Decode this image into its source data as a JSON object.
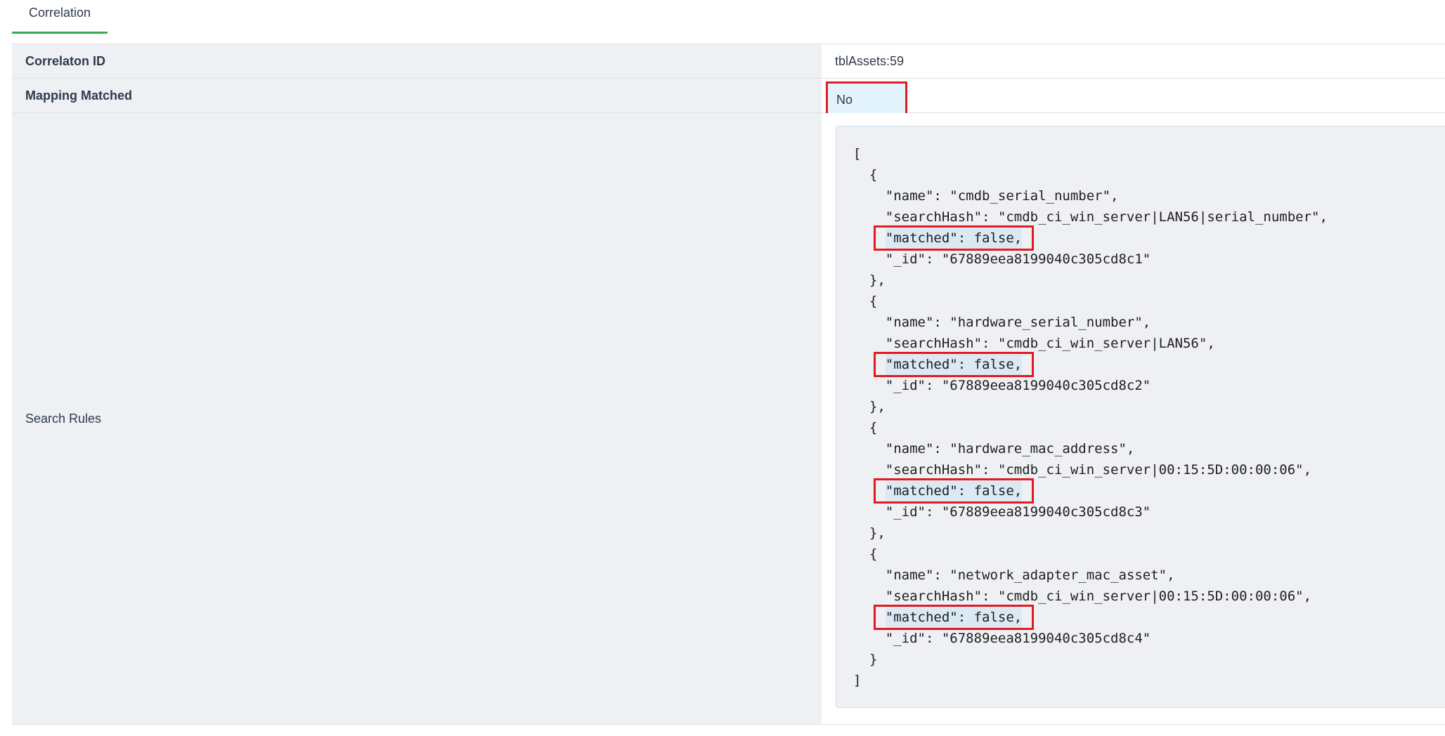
{
  "tabs": [
    {
      "label": "Correlation",
      "active": true
    }
  ],
  "rows": {
    "correlation_id": {
      "label": "Correlaton ID",
      "value": "tblAssets:59"
    },
    "mapping_matched": {
      "label": "Mapping Matched",
      "value": "No"
    },
    "search_rules": {
      "label": "Search Rules"
    }
  },
  "search_rules": {
    "lines": [
      "[",
      "  {",
      "    \"name\": \"cmdb_serial_number\",",
      "    \"searchHash\": \"cmdb_ci_win_server|LAN56|serial_number\",",
      "    \"matched\": false,",
      "    \"_id\": \"67889eea8199040c305cd8c1\"",
      "  },",
      "  {",
      "    \"name\": \"hardware_serial_number\",",
      "    \"searchHash\": \"cmdb_ci_win_server|LAN56\",",
      "    \"matched\": false,",
      "    \"_id\": \"67889eea8199040c305cd8c2\"",
      "  },",
      "  {",
      "    \"name\": \"hardware_mac_address\",",
      "    \"searchHash\": \"cmdb_ci_win_server|00:15:5D:00:00:06\",",
      "    \"matched\": false,",
      "    \"_id\": \"67889eea8199040c305cd8c3\"",
      "  },",
      "  {",
      "    \"name\": \"network_adapter_mac_asset\",",
      "    \"searchHash\": \"cmdb_ci_win_server|00:15:5D:00:00:06\",",
      "    \"matched\": false,",
      "    \"_id\": \"67889eea8199040c305cd8c4\"",
      "  }",
      "]"
    ],
    "highlighted_lines": [
      4,
      10,
      16,
      22
    ]
  },
  "colors": {
    "tab_underline": "#3aaa55",
    "highlight_border": "#e21b23",
    "highlight_fill": "#dbe9f4",
    "label_bg": "#eef0f4"
  }
}
